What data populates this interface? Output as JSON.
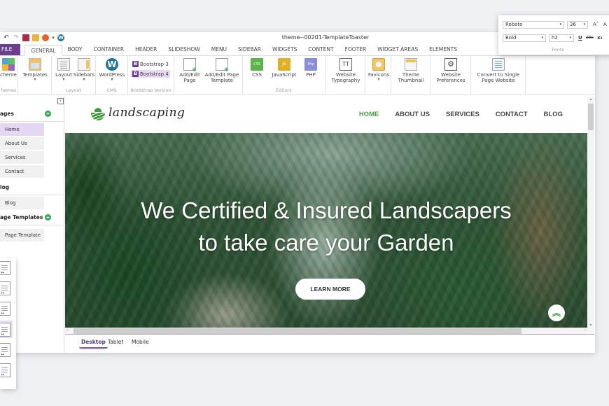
{
  "window": {
    "title": "theme--00201-TemplateToaster",
    "quick_access": [
      "undo-icon",
      "redo-icon",
      "save-icon",
      "open-folder-icon",
      "firefox-preview-icon",
      "wordpress-icon"
    ]
  },
  "tabs": [
    {
      "label": "FILE"
    },
    {
      "label": "GENERAL",
      "active": true
    },
    {
      "label": "BODY"
    },
    {
      "label": "CONTAINER"
    },
    {
      "label": "HEADER"
    },
    {
      "label": "SLIDESHOW"
    },
    {
      "label": "MENU"
    },
    {
      "label": "SIDEBAR"
    },
    {
      "label": "WIDGETS"
    },
    {
      "label": "CONTENT"
    },
    {
      "label": "FOOTER"
    },
    {
      "label": "WIDGET AREAS"
    },
    {
      "label": "ELEMENTS"
    }
  ],
  "ribbon": {
    "groups": {
      "themes": "hemes",
      "layout": "Layout",
      "cms": "CMS",
      "bootstrap": "Bootstrap Version",
      "editors": "Editors"
    },
    "buttons": {
      "scheme": "cheme",
      "templates": "Templates",
      "layout": "Layout",
      "sidebars": "Sidebars",
      "wordpress": "WordPress",
      "bootstrap3": "Bootstrap 3",
      "bootstrap4": "Bootstrap 4",
      "add_edit_page_1": "Add/Edit",
      "add_edit_page_2": "Page",
      "add_edit_tpl_1": "Add/Edit Page",
      "add_edit_tpl_2": "Template",
      "css": "CSS",
      "javascript": "JavaScript",
      "php": "PHP",
      "typography_1": "Website",
      "typography_2": "Typography",
      "favicons": "Favicons",
      "theme_thumb_1": "Theme",
      "theme_thumb_2": "Thumbnail",
      "prefs_1": "Website",
      "prefs_2": "Preferences",
      "single_1": "Convert to Single",
      "single_2": "Page Website"
    },
    "icon_text": {
      "css": "CSS",
      "js": "JS",
      "php": "Php",
      "typo": "TT",
      "wp": "W",
      "bs": "B"
    }
  },
  "fonts_panel": {
    "font_family": "Roboto",
    "font_size": "36",
    "font_weight": "Bold",
    "heading": "h2",
    "grow": "Aˆ",
    "shrink": "A",
    "underline": "U",
    "strike": "abc",
    "subscript": "x₂",
    "label": "Fonts"
  },
  "left_panel": {
    "sections": {
      "pages": "ages",
      "blog": "log",
      "page_templates": "age Templates"
    },
    "pages": [
      "Home",
      "About Us",
      "Services",
      "Contact"
    ],
    "blog": [
      "Blog"
    ],
    "page_templates": [
      "Page Template"
    ]
  },
  "site": {
    "logo": "landscaping",
    "nav": [
      "HOME",
      "ABOUT US",
      "SERVICES",
      "CONTACT",
      "BLOG"
    ],
    "hero_line1": "We Certified & Insured Landscapers",
    "hero_line2": "to take care your Garden",
    "cta": "LEARN MORE",
    "accent": "#4d9a45"
  },
  "device_tabs": [
    {
      "label": "Desktop",
      "active": true
    },
    {
      "label": "Tablet"
    },
    {
      "label": "Mobile"
    }
  ],
  "colors": {
    "file_tab": "#6b3e8f",
    "selected_item": "#e4d7f3",
    "add_button": "#2da44e"
  }
}
